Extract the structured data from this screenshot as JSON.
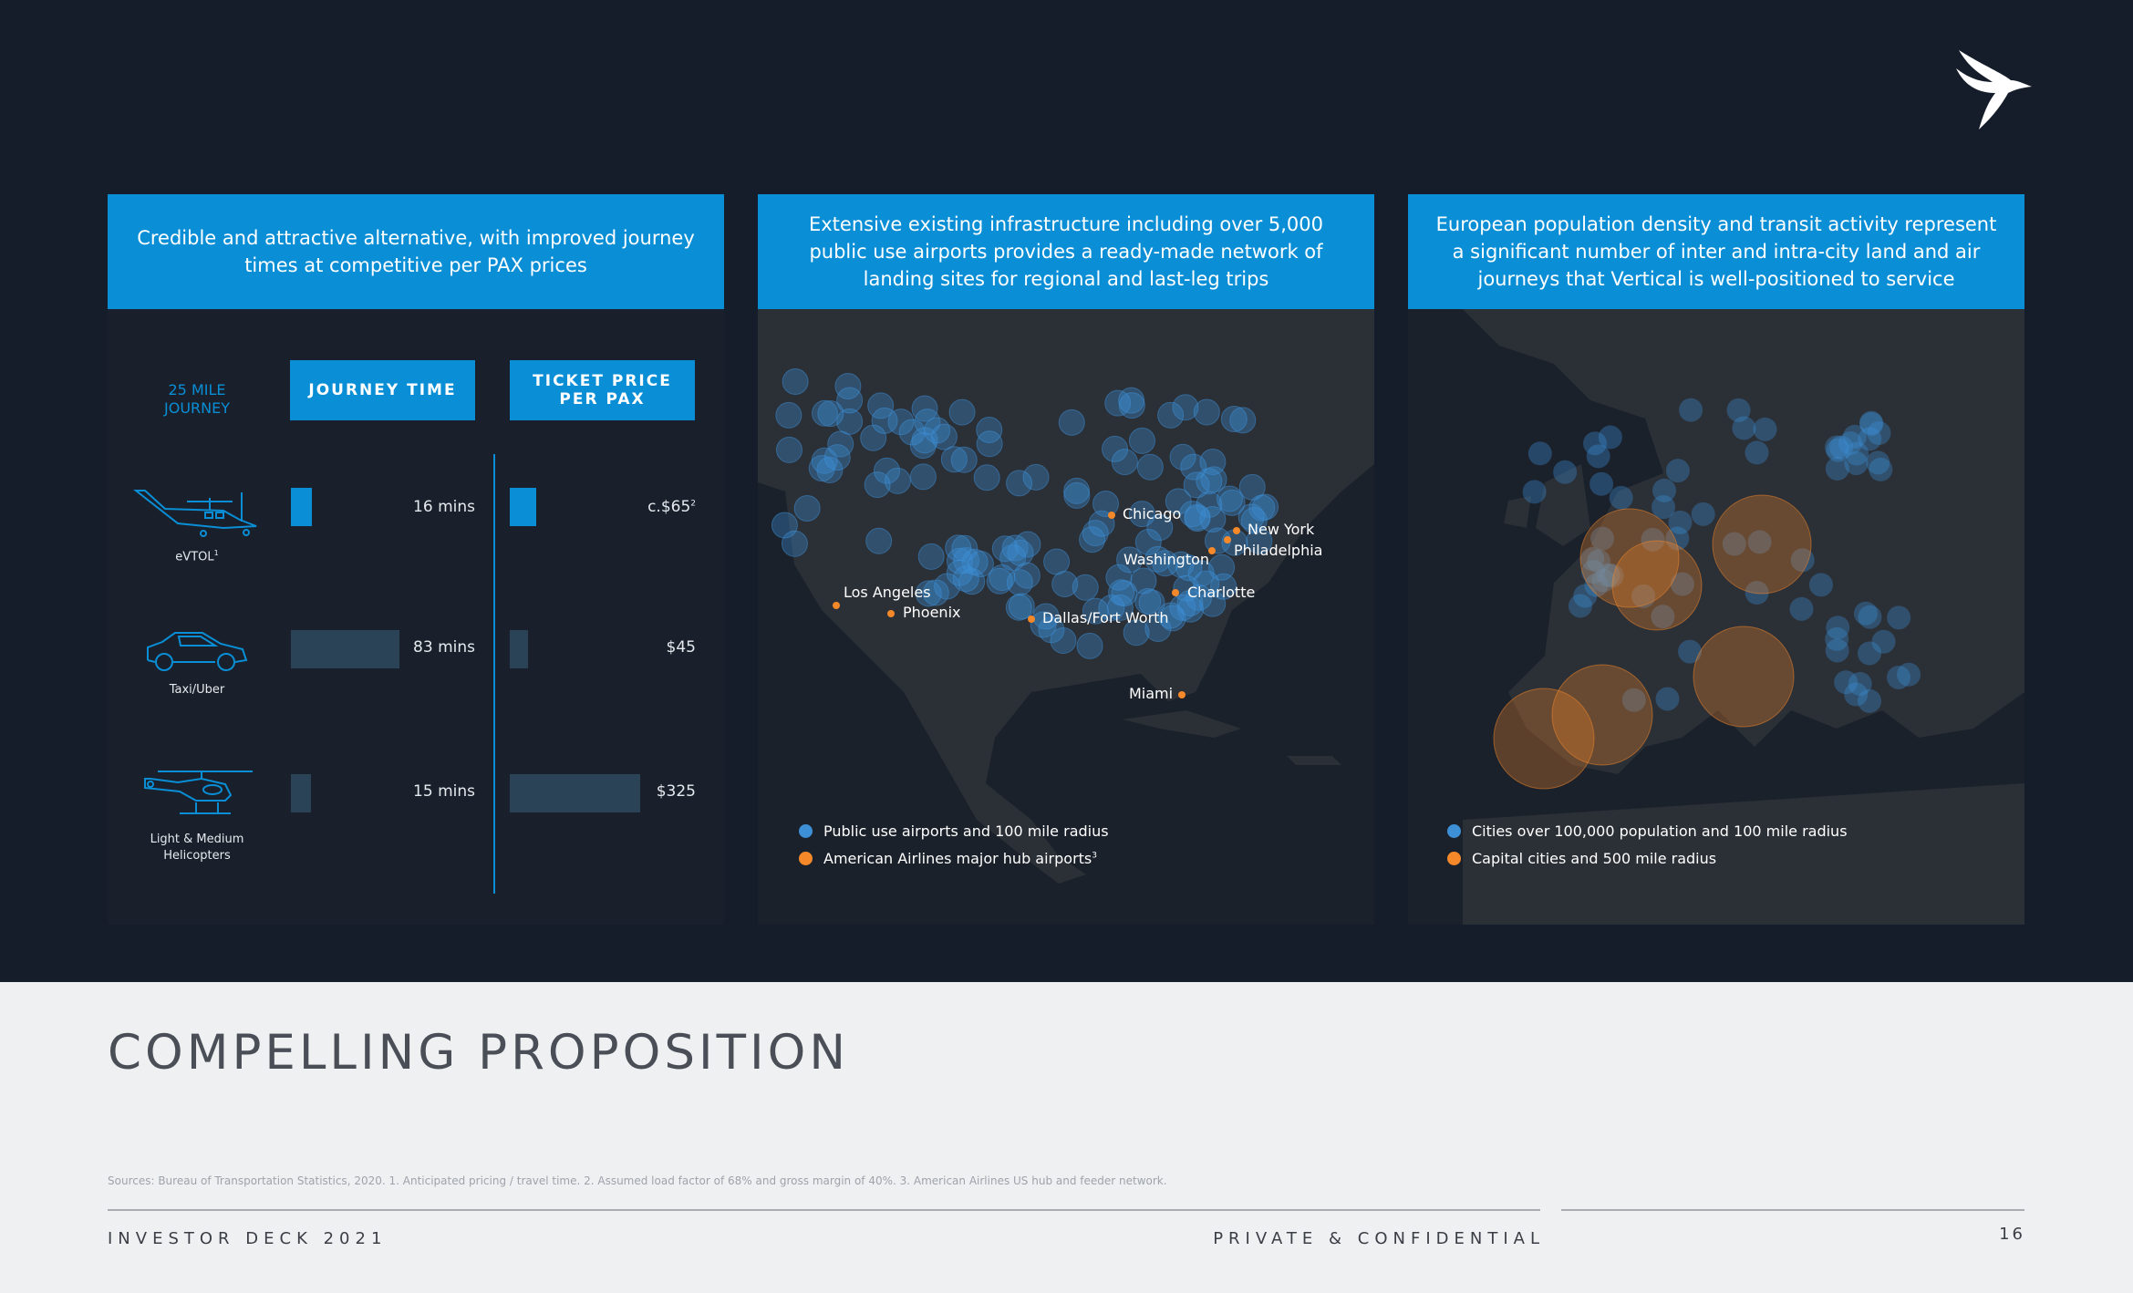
{
  "panels": [
    {
      "heading": "Credible and attractive alternative, with improved journey times at competitive per PAX prices"
    },
    {
      "heading": "Extensive existing infrastructure including over 5,000 public use airports provides a ready-made network of landing sites for regional and last-leg trips"
    },
    {
      "heading": "European population density and transit activity represent a significant number of inter and intra-city land and air journeys that Vertical is well-positioned to service"
    }
  ],
  "comparison": {
    "row_header": "25 MILE JOURNEY",
    "col_journey": "JOURNEY TIME",
    "col_price": "TICKET PRICE PER PAX",
    "rows": [
      {
        "mode": "eVTOL",
        "mode_sup": "1",
        "icon": "evtol-aircraft-icon",
        "time_label": "16 mins",
        "time_minutes": 16,
        "price_label": "c.$65",
        "price_sup": "2",
        "price_usd": 65,
        "highlight": true
      },
      {
        "mode": "Taxi/Uber",
        "mode_sup": "",
        "icon": "car-icon",
        "time_label": "83 mins",
        "time_minutes": 83,
        "price_label": "$45",
        "price_sup": "",
        "price_usd": 45,
        "highlight": false
      },
      {
        "mode": "Light & Medium Helicopters",
        "mode_sup": "",
        "icon": "helicopter-icon",
        "time_label": "15 mins",
        "time_minutes": 15,
        "price_label": "$325",
        "price_sup": "",
        "price_usd": 325,
        "highlight": false
      }
    ]
  },
  "us_map": {
    "cities": [
      "Chicago",
      "New York",
      "Philadelphia",
      "Washington",
      "Charlotte",
      "Los Angeles",
      "Phoenix",
      "Dallas/Fort Worth",
      "Miami"
    ],
    "legend": [
      {
        "label": "Public use airports and 100 mile radius",
        "color": "#3d8fd6"
      },
      {
        "label": "American Airlines major hub airports",
        "sup": "3",
        "color": "#f5892a"
      }
    ]
  },
  "europe_map": {
    "legend": [
      {
        "label": "Cities over 100,000 population and 100 mile radius",
        "color": "#3d8fd6"
      },
      {
        "label": "Capital cities and 500 mile radius",
        "color": "#f5892a"
      }
    ]
  },
  "colors": {
    "accent": "#0a8ed6",
    "dark_bg": "#151c2a",
    "hub": "#f5892a",
    "airport": "#3d8fd6"
  },
  "title": "COMPELLING PROPOSITION",
  "sources": "Sources: Bureau of Transportation Statistics, 2020. 1. Anticipated pricing / travel time. 2. Assumed load factor of 68% and gross margin of 40%. 3. American Airlines US hub and feeder network.",
  "footer": {
    "left": "INVESTOR DECK 2021",
    "center": "PRIVATE & CONFIDENTIAL",
    "page": "16"
  }
}
